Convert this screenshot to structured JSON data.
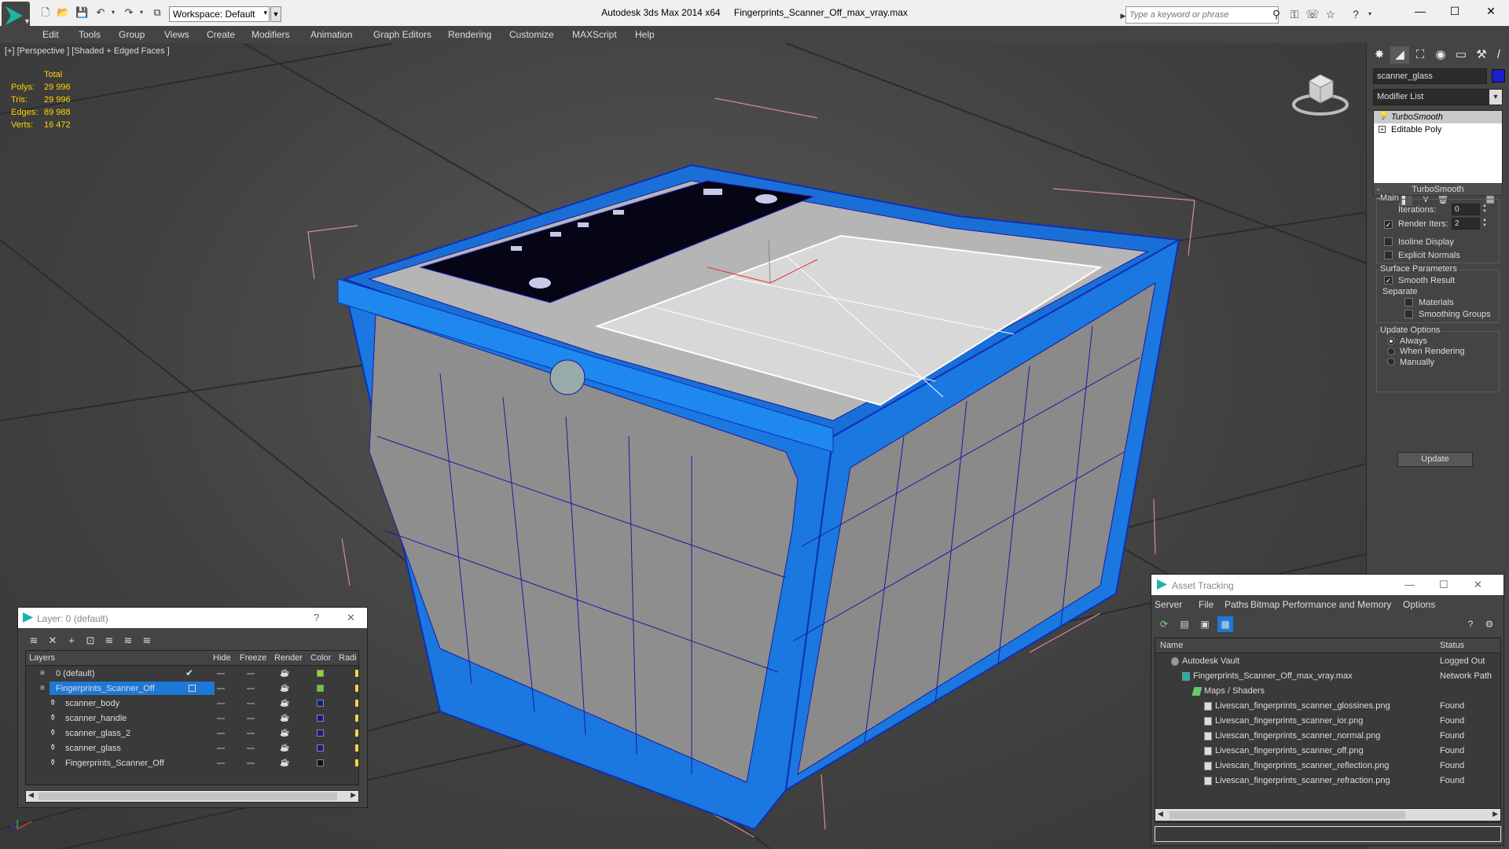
{
  "titlebar": {
    "workspace_label": "Workspace: Default",
    "app_name": "Autodesk 3ds Max  2014 x64",
    "file_name": "Fingerprints_Scanner_Off_max_vray.max",
    "search_placeholder": "Type a keyword or phrase"
  },
  "menu": [
    "Edit",
    "Tools",
    "Group",
    "Views",
    "Create",
    "Modifiers",
    "Animation",
    "Graph Editors",
    "Rendering",
    "Customize",
    "MAXScript",
    "Help"
  ],
  "viewport": {
    "label": "[+] [Perspective ] [Shaded + Edged Faces ]",
    "stats": {
      "header": "Total",
      "rows": [
        {
          "k": "Polys:",
          "v": "29 996"
        },
        {
          "k": "Tris:",
          "v": "29 996"
        },
        {
          "k": "Edges:",
          "v": "89 988"
        },
        {
          "k": "Verts:",
          "v": "16 472"
        }
      ]
    },
    "wire_color": "#1e78d6",
    "wire_dark": "#1a1aa0"
  },
  "command_panel": {
    "object_name": "scanner_glass",
    "object_color": "#1e1ecc",
    "modifier_list": "Modifier List",
    "stack": [
      {
        "label": "TurboSmooth",
        "selected": true,
        "icon": "bulb-icon"
      },
      {
        "label": "Editable Poly",
        "selected": false,
        "icon": "plus-box-icon"
      }
    ],
    "rollout_title": "TurboSmooth",
    "main_group": "Main",
    "iterations_label": "Iterations:",
    "iterations_value": "0",
    "render_iters_label": "Render Iters:",
    "render_iters_value": "2",
    "render_iters_checked": true,
    "isoline_label": "Isoline Display",
    "explicit_label": "Explicit Normals",
    "surface_group": "Surface Parameters",
    "smooth_label": "Smooth Result",
    "separate_label": "Separate",
    "materials_label": "Materials",
    "smoothing_label": "Smoothing Groups",
    "update_group": "Update Options",
    "always_label": "Always",
    "when_rendering_label": "When Rendering",
    "manually_label": "Manually",
    "update_button": "Update"
  },
  "layer_dialog": {
    "title": "Layer: 0 (default)",
    "help": "?",
    "columns": [
      "Layers",
      "Hide",
      "Freeze",
      "Render",
      "Color",
      "Radi"
    ],
    "rows": [
      {
        "name": "0 (default)",
        "color": "#9acd32",
        "checked": true,
        "indent": 1,
        "selected": false
      },
      {
        "name": "Fingerprints_Scanner_Off",
        "color": "#66cc33",
        "checked": false,
        "indent": 1,
        "selected": true
      },
      {
        "name": "scanner_body",
        "color": "#1a1a8c",
        "checked": false,
        "indent": 2,
        "selected": false
      },
      {
        "name": "scanner_handle",
        "color": "#1a1a8c",
        "checked": false,
        "indent": 2,
        "selected": false
      },
      {
        "name": "scanner_glass_2",
        "color": "#1a1a8c",
        "checked": false,
        "indent": 2,
        "selected": false
      },
      {
        "name": "scanner_glass",
        "color": "#1a1a8c",
        "checked": false,
        "indent": 2,
        "selected": false
      },
      {
        "name": "Fingerprints_Scanner_Off",
        "color": "#111111",
        "checked": false,
        "indent": 2,
        "selected": false
      }
    ]
  },
  "asset_dialog": {
    "title": "Asset Tracking",
    "menu": [
      "Server",
      "File",
      "Paths",
      "Bitmap Performance and Memory",
      "Options"
    ],
    "columns": [
      "Name",
      "Status"
    ],
    "rows": [
      {
        "name": "Autodesk Vault",
        "status": "Logged Out",
        "indent": 1
      },
      {
        "name": "Fingerprints_Scanner_Off_max_vray.max",
        "status": "Network Path",
        "indent": 2
      },
      {
        "name": "Maps / Shaders",
        "status": "",
        "indent": 3
      },
      {
        "name": "Livescan_fingerprints_scanner_glossines.png",
        "status": "Found",
        "indent": 4
      },
      {
        "name": "Livescan_fingerprints_scanner_ior.png",
        "status": "Found",
        "indent": 4
      },
      {
        "name": "Livescan_fingerprints_scanner_normal.png",
        "status": "Found",
        "indent": 4
      },
      {
        "name": "Livescan_fingerprints_scanner_off.png",
        "status": "Found",
        "indent": 4
      },
      {
        "name": "Livescan_fingerprints_scanner_reflection.png",
        "status": "Found",
        "indent": 4
      },
      {
        "name": "Livescan_fingerprints_scanner_refraction.png",
        "status": "Found",
        "indent": 4
      }
    ]
  }
}
